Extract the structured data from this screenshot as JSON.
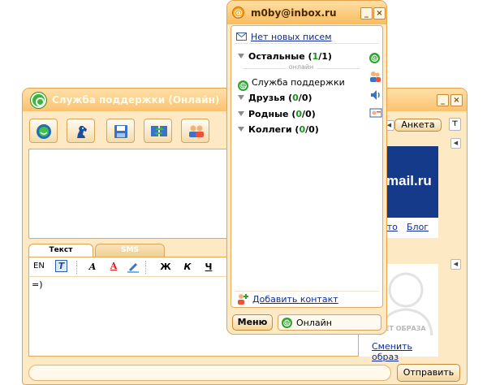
{
  "chat": {
    "title": "Служба поддержки (Онлайн)",
    "window_buttons": {
      "minimize": "_",
      "close": "×"
    },
    "toolbar": [
      "smile",
      "horse",
      "save",
      "transfer",
      "contacts"
    ],
    "profile_button": "Анкета",
    "tabs": {
      "text": "Текст",
      "sms": "SMS"
    },
    "format_lang": "EN",
    "format_bold": "Ж",
    "format_italic": "К",
    "format_underline": "Ч",
    "input_text": "=)",
    "send_button": "Отправить",
    "ad_logo": "mail.ru",
    "links": {
      "photo": "ото",
      "blog": "Блог"
    },
    "no_image_text": "ЕТ ОБРАЗА",
    "change_image_link": "Сменить образ"
  },
  "contact_list": {
    "title": "m0by@inbox.ru",
    "mail_status": "Нет новых писем",
    "groups": [
      {
        "name": "Остальные",
        "online": "1",
        "total": "1"
      },
      {
        "name": "Друзья",
        "online": "0",
        "total": "0"
      },
      {
        "name": "Родные",
        "online": "0",
        "total": "0"
      },
      {
        "name": "Коллеги",
        "online": "0",
        "total": "0"
      }
    ],
    "online_divider": "онлайн",
    "contact": "Служба поддержки",
    "add_contact": "Добавить контакт",
    "menu_button": "Меню",
    "status": "Онлайн"
  },
  "colors": {
    "accent": "#fbc270",
    "frame": "#e6a34d",
    "link": "#0d2a9a",
    "online": "#29a329"
  }
}
